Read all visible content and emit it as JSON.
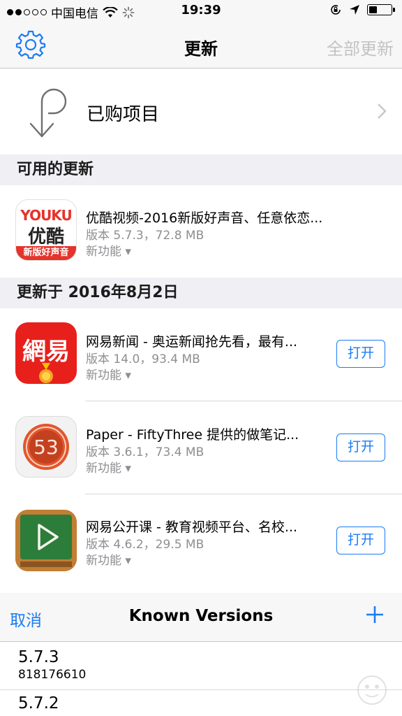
{
  "status_bar": {
    "carrier": "中国电信",
    "time": "19:39"
  },
  "nav": {
    "title": "更新",
    "update_all": "全部更新"
  },
  "purchased": {
    "label": "已购项目"
  },
  "sections": {
    "available": "可用的更新",
    "updated_on": "更新于 2016年8月2日"
  },
  "available_apps": [
    {
      "name": "优酷视频-2016新版好声音、任意依恋...",
      "meta": "版本 5.7.3，72.8 MB",
      "new_features": "新功能 ▾",
      "icon_text_top": "YOUKU",
      "icon_text_mid": "优酷",
      "icon_text_bottom": "新版好声音"
    }
  ],
  "updated_apps": [
    {
      "name": "网易新闻 - 奥运新闻抢先看，最有...",
      "meta": "版本 14.0，93.4 MB",
      "new_features": "新功能 ▾",
      "button": "打开",
      "icon_text": "網易"
    },
    {
      "name": "Paper - FiftyThree 提供的做笔记...",
      "meta": "版本 3.6.1，73.4 MB",
      "new_features": "新功能 ▾",
      "button": "打开",
      "icon_text": "53"
    },
    {
      "name": "网易公开课 - 教育视频平台、名校...",
      "meta": "版本 4.6.2，29.5 MB",
      "new_features": "新功能 ▾",
      "button": "打开"
    }
  ],
  "sheet": {
    "cancel": "取消",
    "title": "Known Versions"
  },
  "versions": [
    {
      "version": "5.7.3",
      "id": "818176610"
    },
    {
      "version": "5.7.2",
      "id": ""
    }
  ],
  "colors": {
    "accent": "#1a7cf4",
    "youku_red": "#e4342b",
    "netease_red": "#e8201c",
    "chalk_green": "#2c7d3a"
  }
}
